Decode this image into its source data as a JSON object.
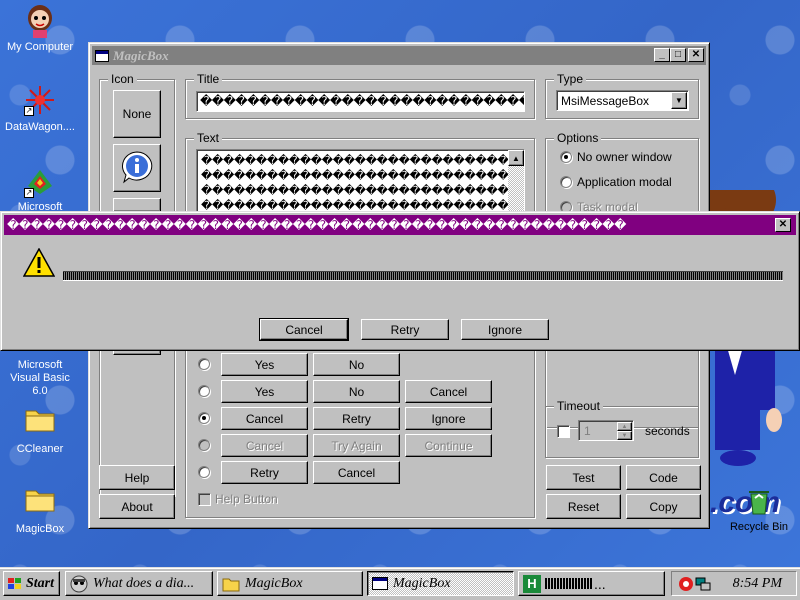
{
  "desktop": {
    "icons": [
      {
        "label": "My Computer"
      },
      {
        "label": "DataWagon...."
      },
      {
        "label": "Microsoft Visual"
      },
      {
        "label": "Microsoft Visual Basic 6.0"
      },
      {
        "label": "CCleaner"
      },
      {
        "label": "MagicBox"
      },
      {
        "label": "Recycle Bin"
      }
    ],
    "partial_text": ".com"
  },
  "magicbox": {
    "title": "MagicBox",
    "icon_group": {
      "label": "Icon",
      "none_label": "None",
      "help_label": "Help",
      "about_label": "About"
    },
    "title_group": {
      "label": "Title",
      "value": "��������������������������������������"
    },
    "text_group": {
      "label": "Text",
      "lines": [
        "�����������������������������",
        "�����������������������������",
        "�����������������������������",
        "�����������������������������"
      ]
    },
    "type_group": {
      "label": "Type",
      "selected": "MsiMessageBox"
    },
    "options_group": {
      "label": "Options",
      "items": [
        {
          "label": "No owner window"
        },
        {
          "label": "Application modal"
        },
        {
          "label": "Task modal"
        }
      ]
    },
    "buttons_rows": [
      {
        "b1": "Yes",
        "b2": "No"
      },
      {
        "b1": "Yes",
        "b2": "No",
        "b3": "Cancel"
      },
      {
        "b1": "Cancel",
        "b2": "Retry",
        "b3": "Ignore"
      },
      {
        "b1": "Cancel",
        "b2": "Try Again",
        "b3": "Continue"
      },
      {
        "b1": "Retry",
        "b2": "Cancel"
      }
    ],
    "help_button_label": "Help Button",
    "timeout": {
      "label": "Timeout",
      "value": "1",
      "unit": "seconds"
    },
    "actions": {
      "test": "Test",
      "code": "Code",
      "reset": "Reset",
      "copy": "Copy"
    }
  },
  "message": {
    "title": "����������������������������������������������������",
    "buttons": {
      "cancel": "Cancel",
      "retry": "Retry",
      "ignore": "Ignore"
    }
  },
  "taskbar": {
    "start": "Start",
    "tasks": [
      {
        "label": "What does a dia..."
      },
      {
        "label": "MagicBox"
      },
      {
        "label": "MagicBox"
      }
    ],
    "clock": "8:54 PM"
  },
  "colors": {
    "message_title_bar": "#800080",
    "desktop": "#3a6ed2",
    "inactive_title": "#808080"
  }
}
